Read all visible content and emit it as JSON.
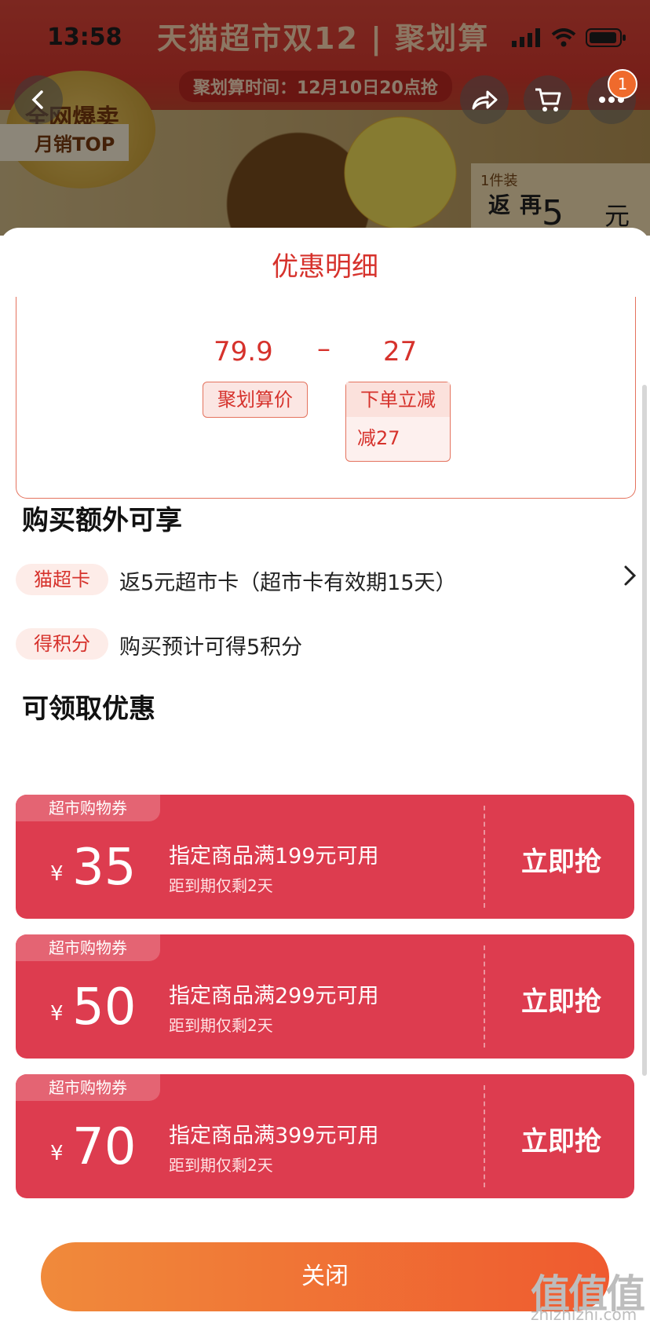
{
  "status_bar": {
    "time": "13:58"
  },
  "background_page": {
    "banner_title": "天猫超市双12 | 聚划算",
    "banner_subtitle": "聚划算时间：12月10日20点抢",
    "badge_line1": "全网爆卖",
    "badge_line2": "月销TOP",
    "side_label": "1件装",
    "side_text": "再返",
    "side_number": "5",
    "side_unit": "元",
    "notification_count": "1"
  },
  "sheet": {
    "title": "优惠明细",
    "calculation": {
      "price": "79.9",
      "operator": "–",
      "discount": "27",
      "price_label": "聚划算价",
      "discount_label": "下单立减",
      "discount_detail": "减27"
    },
    "extra_section_title": "购买额外可享",
    "extras": [
      {
        "tag": "猫超卡",
        "text": "返5元超市卡（超市卡有效期15天）"
      },
      {
        "tag": "得积分",
        "text": "购买预计可得5积分"
      }
    ],
    "coupon_section_title": "可领取优惠",
    "coupons": [
      {
        "tag": "超市购物券",
        "yen": "¥",
        "amount": "35",
        "condition": "指定商品满199元可用",
        "expiry": "距到期仅剩2天",
        "action": "立即抢"
      },
      {
        "tag": "超市购物券",
        "yen": "¥",
        "amount": "50",
        "condition": "指定商品满299元可用",
        "expiry": "距到期仅剩2天",
        "action": "立即抢"
      },
      {
        "tag": "超市购物券",
        "yen": "¥",
        "amount": "70",
        "condition": "指定商品满399元可用",
        "expiry": "距到期仅剩2天",
        "action": "立即抢"
      }
    ],
    "close_label": "关闭"
  },
  "watermark": {
    "text": "值值值",
    "domain": "zhizhizhi.com"
  },
  "colors": {
    "accent": "#d6322c",
    "coupon_bg": "#dd3c4f",
    "close_gradient_start": "#f08a3b",
    "close_gradient_end": "#ef5a2f"
  }
}
